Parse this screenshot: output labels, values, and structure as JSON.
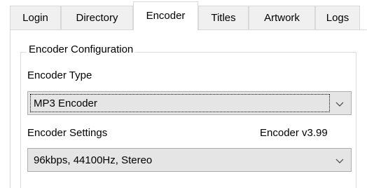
{
  "tabs": [
    {
      "label": "Login"
    },
    {
      "label": "Directory"
    },
    {
      "label": "Encoder"
    },
    {
      "label": "Titles"
    },
    {
      "label": "Artwork"
    },
    {
      "label": "Logs"
    }
  ],
  "group": {
    "title": "Encoder Configuration"
  },
  "encoder_type": {
    "label": "Encoder Type",
    "selected": "MP3 Encoder"
  },
  "encoder_settings": {
    "label": "Encoder Settings",
    "version": "Encoder v3.99",
    "selected": "96kbps, 44100Hz, Stereo"
  },
  "icons": {
    "dropdown": "chevron-down-icon"
  },
  "colors": {
    "tab_bg": "#f0f0f0",
    "active_tab_bg": "#ffffff",
    "select_bg": "#e5e5e5",
    "border": "#d9d9d9"
  }
}
